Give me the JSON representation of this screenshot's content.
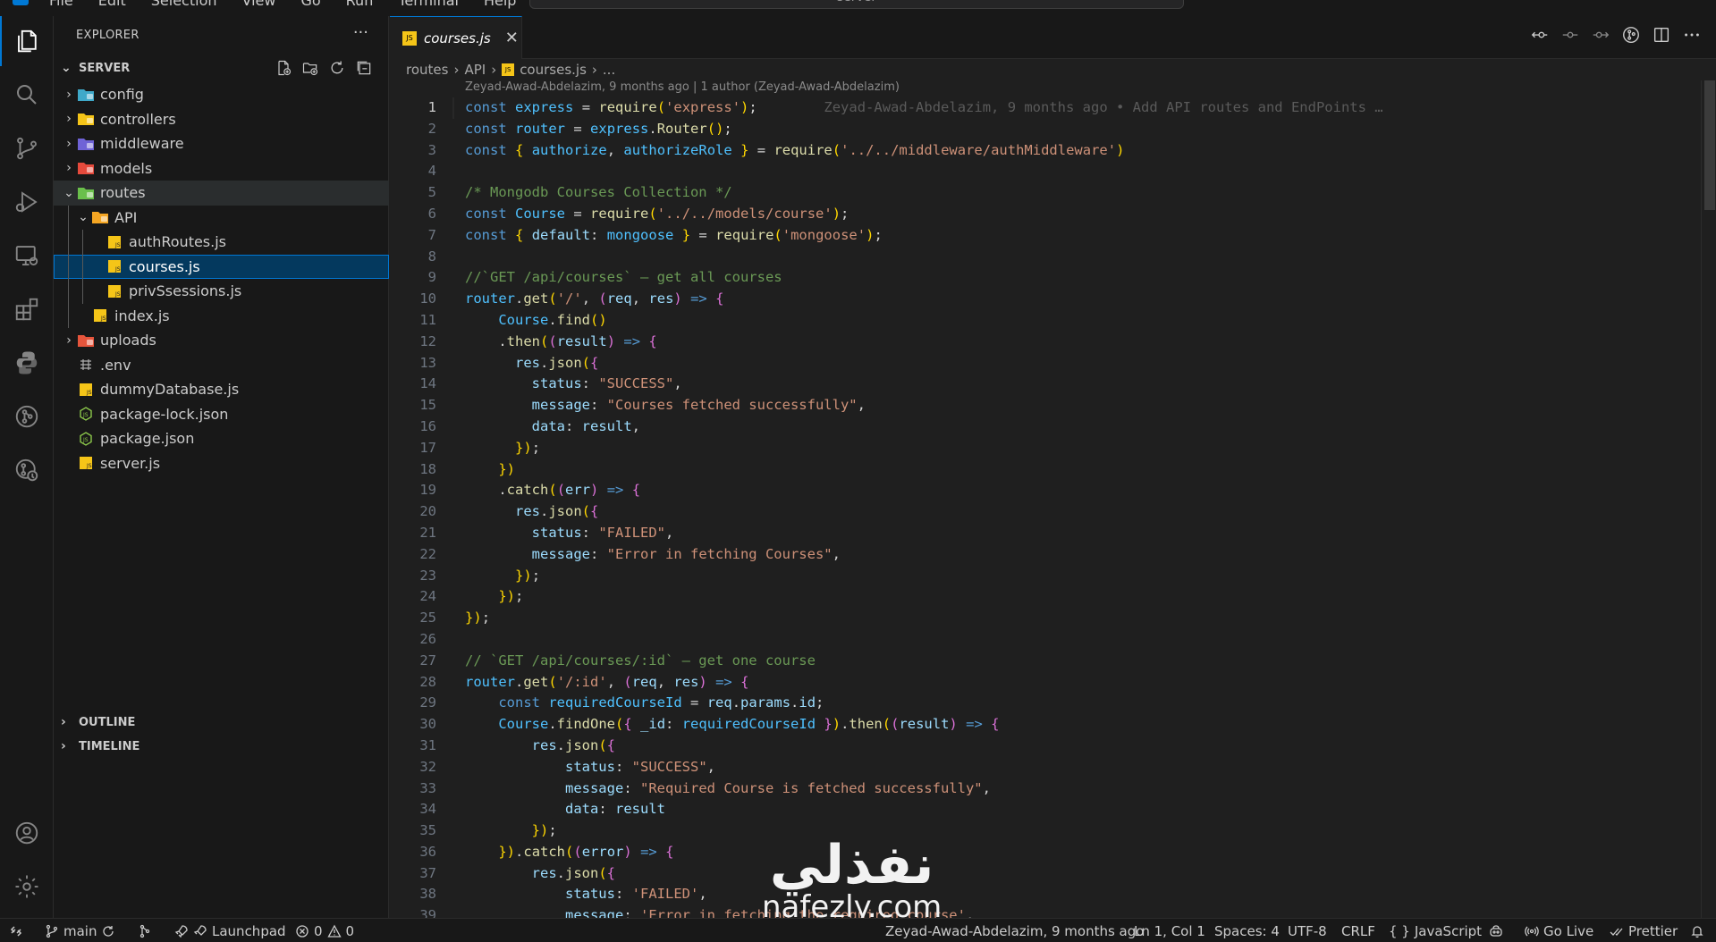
{
  "titlebar": {
    "menu": [
      "File",
      "Edit",
      "Selection",
      "View",
      "Go",
      "Run",
      "Terminal",
      "Help"
    ],
    "command_center": "server"
  },
  "activity_bar": [
    "explorer-icon",
    "search-icon",
    "source-control-icon",
    "run-debug-icon",
    "remote-explorer-icon",
    "extensions-icon",
    "python-icon",
    "git-graph-icon",
    "gitlens-icon",
    "accounts-icon",
    "settings-icon"
  ],
  "sidebar": {
    "title": "EXPLORER",
    "more": "···",
    "section": "SERVER",
    "tree": [
      {
        "label": "config",
        "depth": 0,
        "type": "folder",
        "open": false,
        "color": "#3fa9c9"
      },
      {
        "label": "controllers",
        "depth": 0,
        "type": "folder",
        "open": false,
        "color": "#f5c518"
      },
      {
        "label": "middleware",
        "depth": 0,
        "type": "folder",
        "open": false,
        "color": "#6f63d6"
      },
      {
        "label": "models",
        "depth": 0,
        "type": "folder",
        "open": false,
        "color": "#e64a3c"
      },
      {
        "label": "routes",
        "depth": 0,
        "type": "folder",
        "open": true,
        "color": "#6abf4b"
      },
      {
        "label": "API",
        "depth": 1,
        "type": "folder",
        "open": true,
        "color": "#f5a623"
      },
      {
        "label": "authRoutes.js",
        "depth": 2,
        "type": "js"
      },
      {
        "label": "courses.js",
        "depth": 2,
        "type": "js"
      },
      {
        "label": "privSsessions.js",
        "depth": 2,
        "type": "js"
      },
      {
        "label": "index.js",
        "depth": 1,
        "type": "js"
      },
      {
        "label": "uploads",
        "depth": 0,
        "type": "folder",
        "open": false,
        "color": "#e6553c"
      },
      {
        "label": ".env",
        "depth": 0,
        "type": "env"
      },
      {
        "label": "dummyDatabase.js",
        "depth": 0,
        "type": "js"
      },
      {
        "label": "package-lock.json",
        "depth": 0,
        "type": "node"
      },
      {
        "label": "package.json",
        "depth": 0,
        "type": "node"
      },
      {
        "label": "server.js",
        "depth": 0,
        "type": "js"
      }
    ],
    "outline": "OUTLINE",
    "timeline": "TIMELINE"
  },
  "tab": {
    "label": "courses.js",
    "close": "✕"
  },
  "breadcrumbs": [
    "routes",
    "API",
    "courses.js",
    "..."
  ],
  "blame_header": "Zeyad-Awad-Abdelazim, 9 months ago | 1 author (Zeyad-Awad-Abdelazim)",
  "inline_blame": "Zeyad-Awad-Abdelazim, 9 months ago • Add API routes and EndPoints …",
  "code_lines": [
    "const express = require('express');",
    "const router = express.Router();",
    "const { authorize, authorizeRole } = require('../../middleware/authMiddleware')",
    "",
    "/* Mongodb Courses Collection */",
    "const Course = require('../../models/course');",
    "const { default: mongoose } = require('mongoose');",
    "",
    "//`GET /api/courses` — get all courses",
    "router.get('/', (req, res) => {",
    "    Course.find()",
    "    .then((result) => {",
    "      res.json({",
    "        status: \"SUCCESS\",",
    "        message: \"Courses fetched successfully\",",
    "        data: result,",
    "      });",
    "    })",
    "    .catch((err) => {",
    "      res.json({",
    "        status: \"FAILED\",",
    "        message: \"Error in fetching Courses\",",
    "      });",
    "    });",
    "});",
    "",
    "// `GET /api/courses/:id` — get one course",
    "router.get('/:id', (req, res) => {",
    "    const requiredCourseId = req.params.id;",
    "    Course.findOne({ _id: requiredCourseId }).then((result) => {",
    "        res.json({",
    "            status: \"SUCCESS\",",
    "            message: \"Required Course is fetched successfully\",",
    "            data: result",
    "        });",
    "    }).catch((error) => {",
    "        res.json({",
    "            status: 'FAILED',",
    "            message: 'Error in fetching the required course',"
  ],
  "watermark": {
    "arabic": "نفذلي",
    "latin": "nafezly.com"
  },
  "statusbar": {
    "branch": "main",
    "launchpad": "Launchpad",
    "errors": "0",
    "warnings": "0",
    "blame": "Zeyad-Awad-Abdelazim, 9 months ago",
    "position": "Ln 1, Col 1",
    "spaces": "Spaces: 4",
    "encoding": "UTF-8",
    "eol": "CRLF",
    "language": "JavaScript",
    "golive": "Go Live",
    "prettier": "Prettier"
  }
}
